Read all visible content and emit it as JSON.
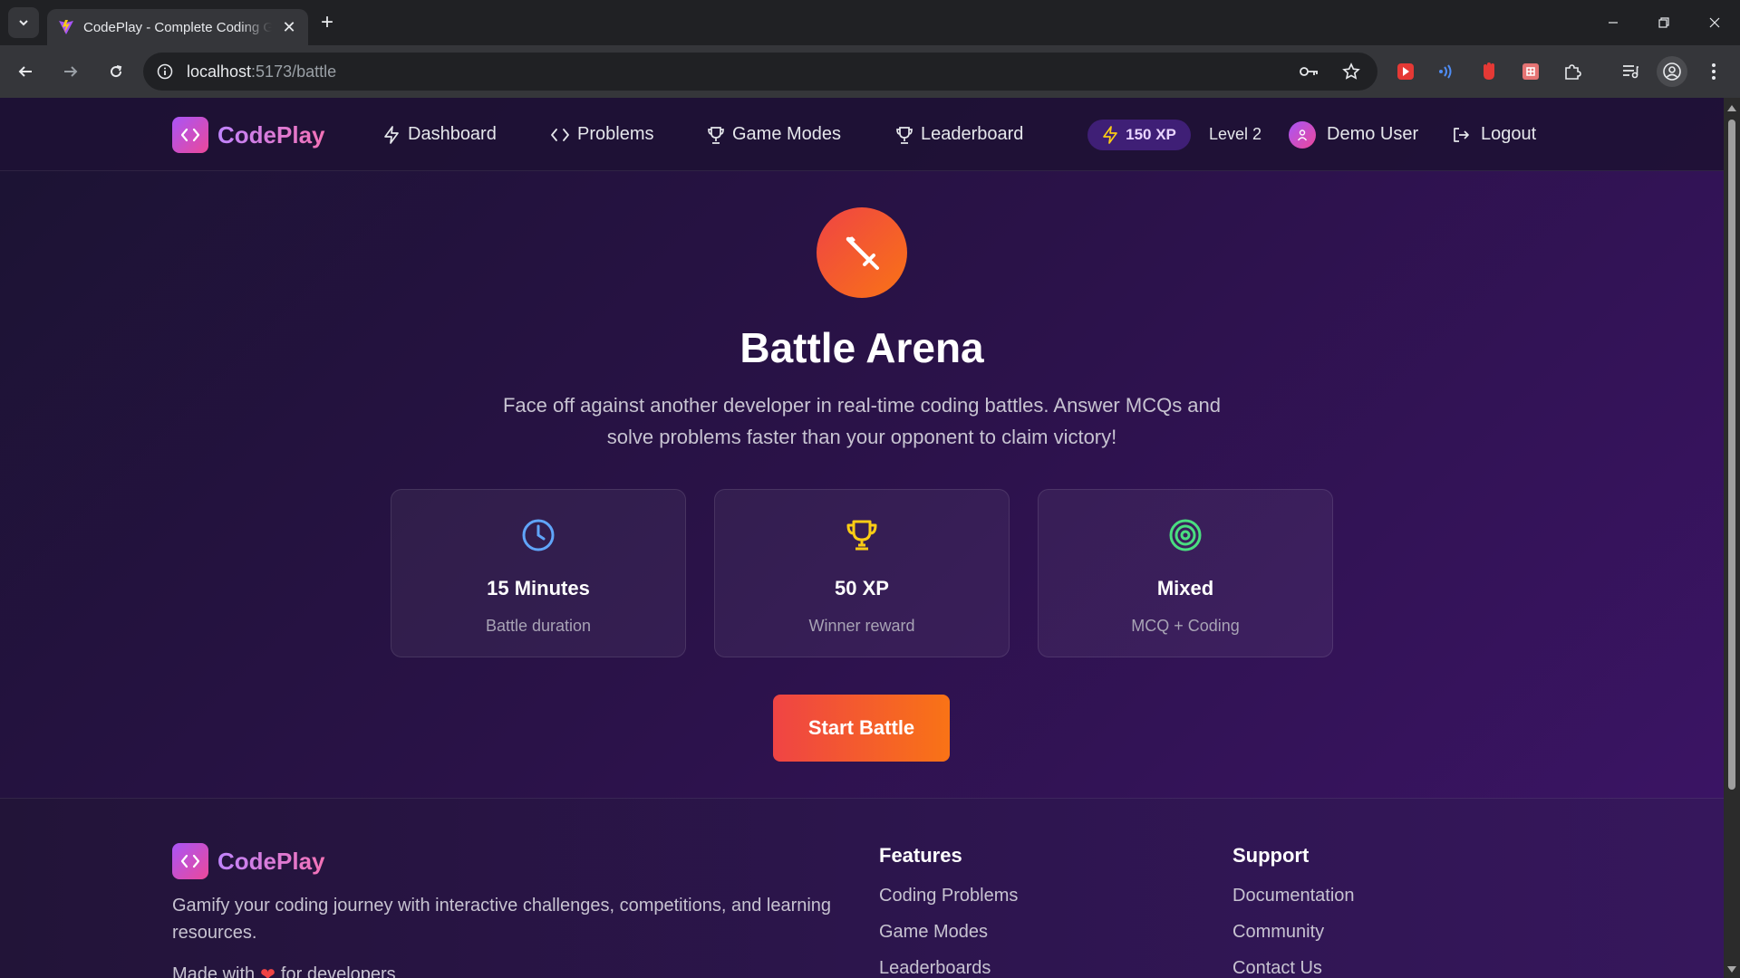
{
  "browser": {
    "tab_title": "CodePlay - Complete Coding Gamification Platform",
    "url_host": "localhost",
    "url_path": ":5173/battle"
  },
  "header": {
    "brand": "CodePlay",
    "nav": [
      {
        "label": "Dashboard",
        "icon": "lightning-icon"
      },
      {
        "label": "Problems",
        "icon": "code-icon"
      },
      {
        "label": "Game Modes",
        "icon": "trophy-icon"
      },
      {
        "label": "Leaderboard",
        "icon": "trophy-icon"
      }
    ],
    "xp": "150 XP",
    "level": "Level 2",
    "user": "Demo User",
    "logout": "Logout"
  },
  "hero": {
    "title": "Battle Arena",
    "description": "Face off against another developer in real-time coding battles. Answer MCQs and solve problems faster than your opponent to claim victory!",
    "icon": "sword-icon"
  },
  "stats": [
    {
      "value": "15 Minutes",
      "label": "Battle duration",
      "icon": "clock-icon",
      "color": "#60a5fa"
    },
    {
      "value": "50 XP",
      "label": "Winner reward",
      "icon": "trophy-icon",
      "color": "#facc15"
    },
    {
      "value": "Mixed",
      "label": "MCQ + Coding",
      "icon": "target-icon",
      "color": "#4ade80"
    }
  ],
  "start_button": "Start Battle",
  "footer": {
    "brand": "CodePlay",
    "description": "Gamify your coding journey with interactive challenges, competitions, and learning resources.",
    "made_prefix": "Made with",
    "made_suffix": "for developers",
    "features": {
      "title": "Features",
      "links": [
        "Coding Problems",
        "Game Modes",
        "Leaderboards"
      ]
    },
    "support": {
      "title": "Support",
      "links": [
        "Documentation",
        "Community",
        "Contact Us"
      ]
    }
  },
  "colors": {
    "accent_purple": "#a855f7",
    "accent_pink": "#ec4899",
    "battle_red": "#ef4444",
    "battle_orange": "#f97316"
  }
}
